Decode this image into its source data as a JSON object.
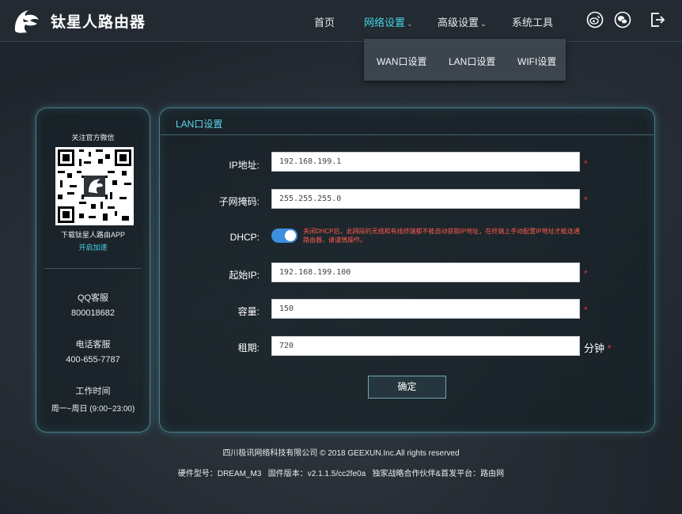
{
  "header": {
    "brand": "钛星人路由器",
    "nav": [
      {
        "label": "首页"
      },
      {
        "label": "网络设置",
        "active": true
      },
      {
        "label": "高级设置"
      },
      {
        "label": "系统工具"
      }
    ],
    "icons": [
      "weibo-icon",
      "wechat-icon",
      "logout-icon"
    ]
  },
  "dropdown": {
    "items": [
      "WAN口设置",
      "LAN口设置",
      "WIFI设置"
    ]
  },
  "sidebar": {
    "follow_text": "关注官方微信",
    "download_text": "下载钛星人路由APP",
    "speed_link": "开启加速",
    "qq_label": "QQ客服",
    "qq_value": "800018682",
    "phone_label": "电话客服",
    "phone_value": "400-655-7787",
    "hours_label": "工作时间",
    "hours_value": "周一~周日 (9:00~23:00)"
  },
  "main": {
    "title": "LAN口设置",
    "fields": {
      "ip_label": "IP地址:",
      "ip_value": "192.168.199.1",
      "mask_label": "子网掩码:",
      "mask_value": "255.255.255.0",
      "dhcp_label": "DHCP:",
      "dhcp_enabled": true,
      "dhcp_note": "关闭DHCP后，此网段的无线和有线终端都不能自动获取IP地址，在终端上手动配置IP地址才能连通路由器，请谨慎操作。",
      "start_label": "起始IP:",
      "start_value": "192.168.199.100",
      "capacity_label": "容量:",
      "capacity_value": "150",
      "lease_label": "租期:",
      "lease_value": "720",
      "lease_unit": "分钟",
      "required_mark": "*"
    },
    "confirm_label": "确定"
  },
  "footer": {
    "copyright": "四川极讯网络科技有限公司 © 2018 GEEXUN.Inc.All rights reserved",
    "versions": "硬件型号：DREAM_M3   固件版本：v2.1.1.5/cc2fe0a   独家战略合作伙伴&首发平台：路由网"
  },
  "colors": {
    "accent": "#46d3e8",
    "toggle_on": "#3f8fe0",
    "warning": "#ff5a4a",
    "required": "#e03a3a"
  }
}
